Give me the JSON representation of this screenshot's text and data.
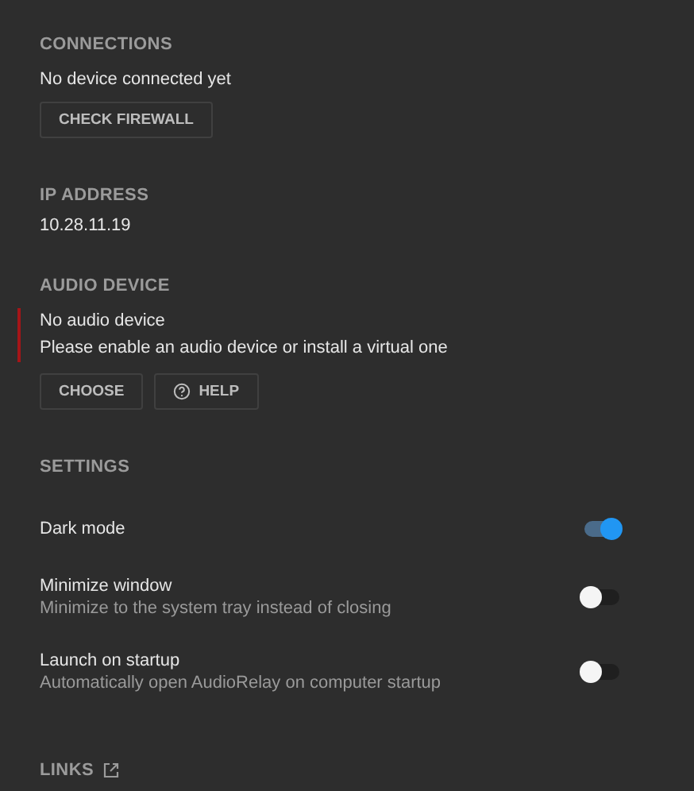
{
  "connections": {
    "heading": "CONNECTIONS",
    "status": "No device connected yet",
    "button": "CHECK FIREWALL"
  },
  "ip_address": {
    "heading": "IP ADDRESS",
    "value": "10.28.11.19"
  },
  "audio_device": {
    "heading": "AUDIO DEVICE",
    "error": true,
    "title": "No audio device",
    "message": "Please enable an audio device or install a virtual one",
    "buttons": [
      {
        "label": "CHOOSE",
        "kind": "plain"
      },
      {
        "label": "HELP",
        "kind": "help"
      }
    ]
  },
  "settings": {
    "heading": "SETTINGS",
    "items": [
      {
        "label": "Dark mode",
        "on": true
      },
      {
        "label": "Minimize window",
        "description": "Minimize to the system tray instead of closing",
        "on": false
      },
      {
        "label": "Launch on startup",
        "description": "Automatically open AudioRelay on computer startup",
        "on": false
      }
    ]
  },
  "links": {
    "heading": "LINKS"
  }
}
